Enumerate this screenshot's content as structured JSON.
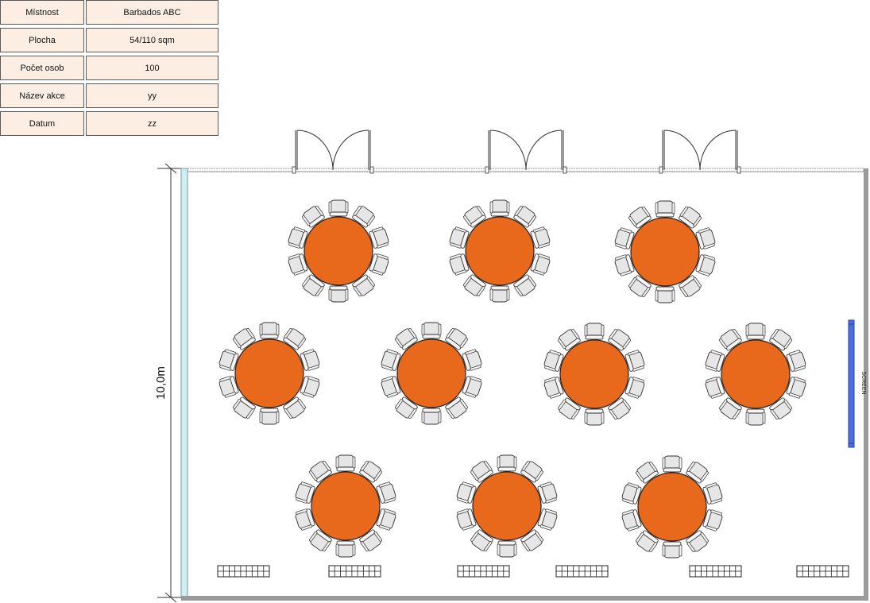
{
  "info": [
    {
      "label": "Místnost",
      "value": "Barbados ABC"
    },
    {
      "label": "Plocha",
      "value": "54/110 sqm"
    },
    {
      "label": "Počet osob",
      "value": "100"
    },
    {
      "label": "Název akce",
      "value": "yy"
    },
    {
      "label": "Datum",
      "value": "zz"
    }
  ],
  "plan": {
    "dimension_label": "10,0m",
    "screen_label": "SCREEN",
    "table_count": 10,
    "chairs_per_table": 10,
    "door_count": 3,
    "radiator_count": 6,
    "colors": {
      "table_fill": "#e8691c",
      "chair_fill": "#e6e6e6",
      "wall": "#9a9a9a",
      "window_glass": "#cfeff5",
      "screen": "#4a6fe0",
      "info_cell": "#fdeee4"
    }
  }
}
